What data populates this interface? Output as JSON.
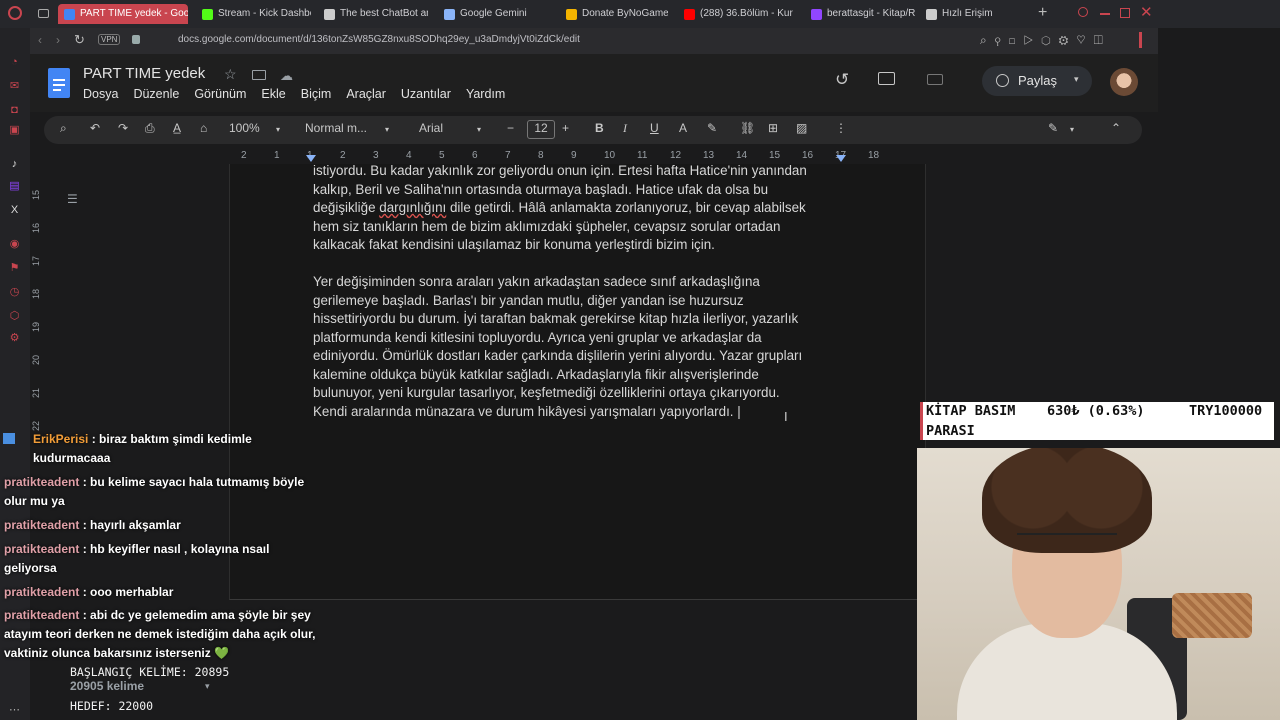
{
  "browser": {
    "tabs": [
      {
        "label": "PART TIME yedek - Goog",
        "active": true,
        "icon": "docs-icon",
        "color": "#4285f4"
      },
      {
        "label": "Stream - Kick Dashbo",
        "active": false,
        "icon": "kick-icon",
        "color": "#53fc18"
      },
      {
        "label": "The best ChatBot and",
        "active": false,
        "icon": "chatbot-icon",
        "color": "#cccccc"
      },
      {
        "label": "Google Gemini",
        "active": false,
        "icon": "gemini-icon",
        "color": "#8ab4f8"
      },
      {
        "label": "Donate ByNoGame - C",
        "active": false,
        "icon": "bynogame-icon",
        "color": "#f4b400"
      },
      {
        "label": "(288) 36.Bölüm - Kurt",
        "active": false,
        "icon": "youtube-icon",
        "color": "#ff0000"
      },
      {
        "label": "berattasgit - Kitap/Ro",
        "active": false,
        "icon": "twitch-icon",
        "color": "#9146ff"
      },
      {
        "label": "Hızlı Erişim",
        "active": false,
        "icon": "grid-icon",
        "color": "#cccccc"
      }
    ],
    "url": "docs.google.com/document/d/136tonZsW85GZ8nxu8SODhq29ey_u3aDmdyjVt0iZdCk/edit",
    "vpn_label": "VPN"
  },
  "doc": {
    "title": "PART TIME yedek",
    "menu": [
      "Dosya",
      "Düzenle",
      "Görünüm",
      "Ekle",
      "Biçim",
      "Araçlar",
      "Uzantılar",
      "Yardım"
    ],
    "share_label": "Paylaş",
    "zoom": "100%",
    "style": "Normal m...",
    "font": "Arial",
    "font_size": "12",
    "ruler": [
      "2",
      "1",
      "1",
      "2",
      "3",
      "4",
      "5",
      "6",
      "7",
      "8",
      "9",
      "10",
      "11",
      "12",
      "13",
      "14",
      "15",
      "16",
      "17",
      "18"
    ],
    "vruler": [
      "15",
      "16",
      "17",
      "18",
      "19",
      "20",
      "21",
      "22"
    ],
    "para1": {
      "lines": [
        "istiyordu. Bu kadar yakınlık zor geliyordu onun için. Ertesi hafta Hatice'nin yanından",
        "kalkıp, Beril ve Saliha'nın ortasında oturmaya başladı. Hatice ufak da olsa bu",
        "hem siz tanıkların hem de bizim aklımızdaki şüpheler, cevapsız sorular ortadan",
        "kalkacak fakat kendisini ulaşılamaz bir konuma yerleştirdi bizim için."
      ],
      "line3_pre": "değişikliğe ",
      "line3_misspelled": "dargınlığını",
      "line3_post": " dile getirdi. Hâlâ anlamakta zorlanıyoruz, bir cevap alabilsek"
    },
    "para2": {
      "lines": [
        "Yer değişiminden sonra araları yakın arkadaştan sadece sınıf arkadaşlığına",
        "gerilemeye başladı. Barlas'ı bir yandan mutlu, diğer yandan ise huzursuz",
        "hissettiriyordu bu durum. İyi taraftan bakmak gerekirse kitap hızla ilerliyor, yazarlık",
        "platformunda kendi kitlesini topluyordu. Ayrıca yeni gruplar ve arkadaşlar da",
        "ediniyordu. Ömürlük dostları kader çarkında dişlilerin yerini alıyordu. Yazar grupları",
        "kalemine oldukça büyük katkılar sağladı. Arkadaşlarıyla fikir alışverişlerinde",
        "bulunuyor, yeni kurgular tasarlıyor, keşfetmediği özelliklerini ortaya çıkarıyordu.",
        "Kendi aralarında münazara ve durum hikâyesi yarışmaları yapıyorlardı. |"
      ]
    }
  },
  "chat": [
    {
      "user": "ErikPerisi",
      "text": " : biraz baktım şimdi kedimle kudurmacaaa",
      "orange": true
    },
    {
      "user": "pratikteadent",
      "text": " : bu kelime sayacı hala tutmamış böyle olur mu ya",
      "orange": false
    },
    {
      "user": "pratikteadent",
      "text": " : hayırlı akşamlar",
      "orange": false
    },
    {
      "user": "pratikteadent",
      "text": " : hb keyifler nasıl , kolayına nsaıl geliyorsa",
      "orange": false
    },
    {
      "user": "pratikteadent",
      "text": " : ooo merhablar",
      "orange": false
    },
    {
      "user": "pratikteadent",
      "text": " : abi dc ye gelemedim ama şöyle bir şey atayım teori derken ne demek istediğim daha açık olur, vaktiniz olunca bakarsınız isterseniz 💚",
      "orange": false
    }
  ],
  "overlay": {
    "start_words": "BAŞLANGIÇ KELİME: 20895",
    "word_count": "20905 kelime",
    "goal": "HEDEF: 22000",
    "kitap_label1": "KİTAP BASIM",
    "kitap_label2": "PARASI",
    "kitap_value": "630₺ (0.63%)",
    "kitap_goal": "TRY100000"
  }
}
